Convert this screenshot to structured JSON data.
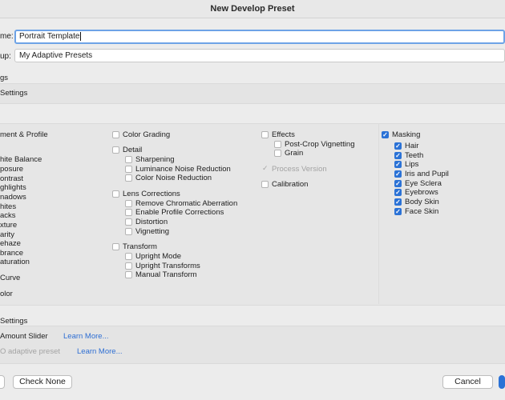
{
  "window": {
    "title": "New Develop Preset"
  },
  "form": {
    "name_label": "me:",
    "name_value": "Portrait Template",
    "group_label": "up:",
    "group_value": "My Adaptive Presets"
  },
  "sections": {
    "settings_header": "gs",
    "auto_settings": "Settings",
    "masking_settings_header": "Settings",
    "amount_slider": "Amount Slider",
    "learn_more_1": "Learn More...",
    "adaptive_preset": "O adaptive preset",
    "learn_more_2": "Learn More..."
  },
  "col0": {
    "items": [
      "ment & Profile",
      "hite Balance",
      "posure",
      "ontrast",
      "ghlights",
      "nadows",
      "hites",
      "acks",
      "xture",
      "arity",
      "ehaze",
      "brance",
      "aturation",
      "Curve",
      "olor"
    ]
  },
  "col1": {
    "color_grading": "Color Grading",
    "detail": "Detail",
    "detail_items": [
      "Sharpening",
      "Luminance Noise Reduction",
      "Color Noise Reduction"
    ],
    "lens_corrections": "Lens Corrections",
    "lens_items": [
      "Remove Chromatic Aberration",
      "Enable Profile Corrections",
      "Distortion",
      "Vignetting"
    ],
    "transform": "Transform",
    "transform_items": [
      "Upright Mode",
      "Upright Transforms",
      "Manual Transform"
    ]
  },
  "col2": {
    "effects": "Effects",
    "effects_items": [
      "Post-Crop Vignetting",
      "Grain"
    ],
    "process_version": "Process Version",
    "calibration": "Calibration"
  },
  "col3": {
    "masking": "Masking",
    "masking_items": [
      "Hair",
      "Teeth",
      "Lips",
      "Iris and Pupil",
      "Eye Sclera",
      "Eyebrows",
      "Body Skin",
      "Face Skin"
    ]
  },
  "buttons": {
    "check_none": "Check None",
    "cancel": "Cancel"
  },
  "colors": {
    "accent": "#2b72d6",
    "link": "#2f6fd3",
    "focus_ring": "#6ea3e6"
  },
  "icons": {
    "checkmark": "✓"
  }
}
